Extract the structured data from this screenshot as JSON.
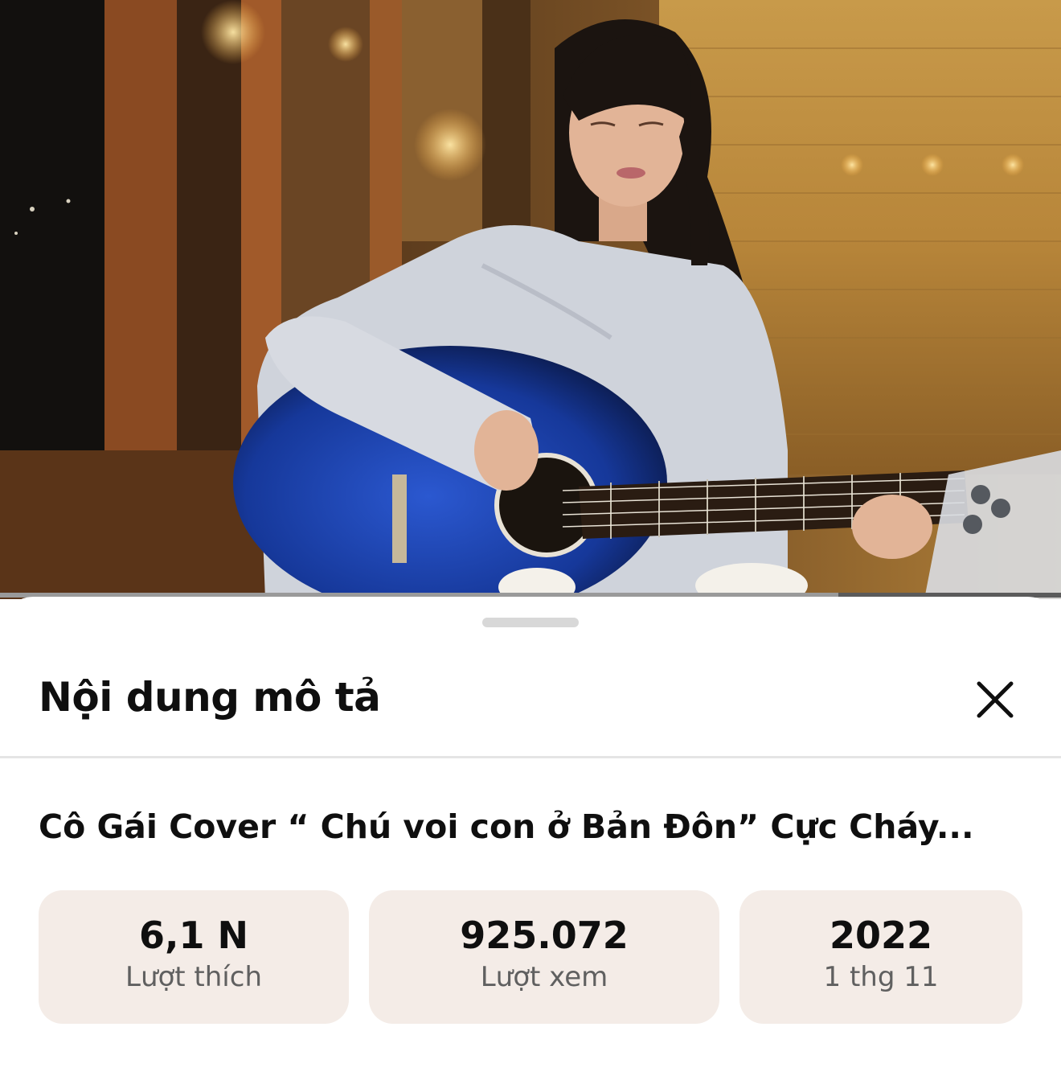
{
  "video": {
    "thumbnail": "woman-playing-blue-acoustic-guitar",
    "progress_fraction": 0.79
  },
  "sheet": {
    "title": "Nội dung mô tả",
    "close_icon": "close-icon",
    "video_title": "Cô Gái Cover “ Chú voi con ở Bản Đôn” Cực Cháy...",
    "stats": {
      "likes": {
        "value": "6,1 N",
        "label": "Lượt thích"
      },
      "views": {
        "value": "925.072",
        "label": "Lượt xem"
      },
      "date": {
        "value": "2022",
        "label": "1 thg 11"
      }
    },
    "colors": {
      "stat_background": "#f4ece7",
      "title_text": "#0f0f0f",
      "label_text": "#606060",
      "guitar_blue": "#1a3fa8"
    }
  }
}
